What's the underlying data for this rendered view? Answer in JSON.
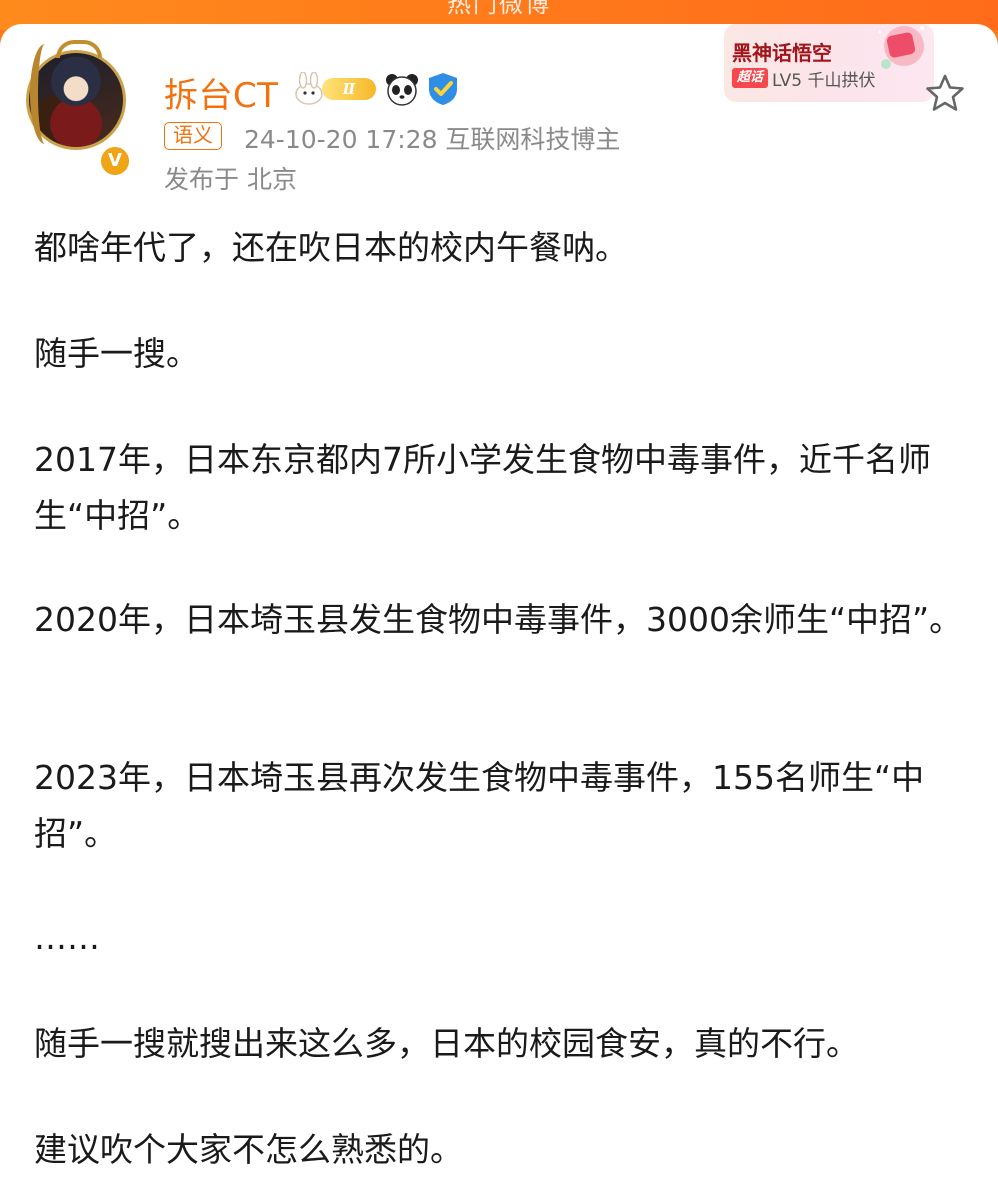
{
  "header": {
    "banner_text": "热门微博"
  },
  "post": {
    "author": {
      "name": "拆台CT",
      "level_badge": "Ⅱ"
    },
    "meta": {
      "tag": "语义",
      "time_and_category": "24-10-20 17:28  互联网科技博主",
      "location": "发布于 北京"
    },
    "supertopic": {
      "title": "黑神话悟空",
      "tag": "超话",
      "level": "LV5 千山拱伏"
    },
    "paragraphs": [
      "都啥年代了，还在吹日本的校内午餐呐。",
      "随手一搜。",
      "2017年，日本东京都内7所小学发生食物中毒事件，近千名师生“中招”。",
      "2020年，日本埼玉县发生食物中毒事件，3000余师生“中招”。",
      "2023年，日本埼玉县再次发生食物中毒事件，155名师生“中招”。",
      "……",
      "随手一搜就搜出来这么多，日本的校园食安，真的不行。",
      "建议吹个大家不怎么熟悉的。"
    ]
  },
  "colors": {
    "accent": "#f1720f",
    "meta_text": "#8a8a8a",
    "body_text": "#1a1a1a",
    "supertopic_red": "#a0151b"
  },
  "icons": [
    "verified-v-icon",
    "rabbit-badge-icon",
    "panda-badge-icon",
    "shield-badge-icon",
    "star-favorite-icon"
  ]
}
